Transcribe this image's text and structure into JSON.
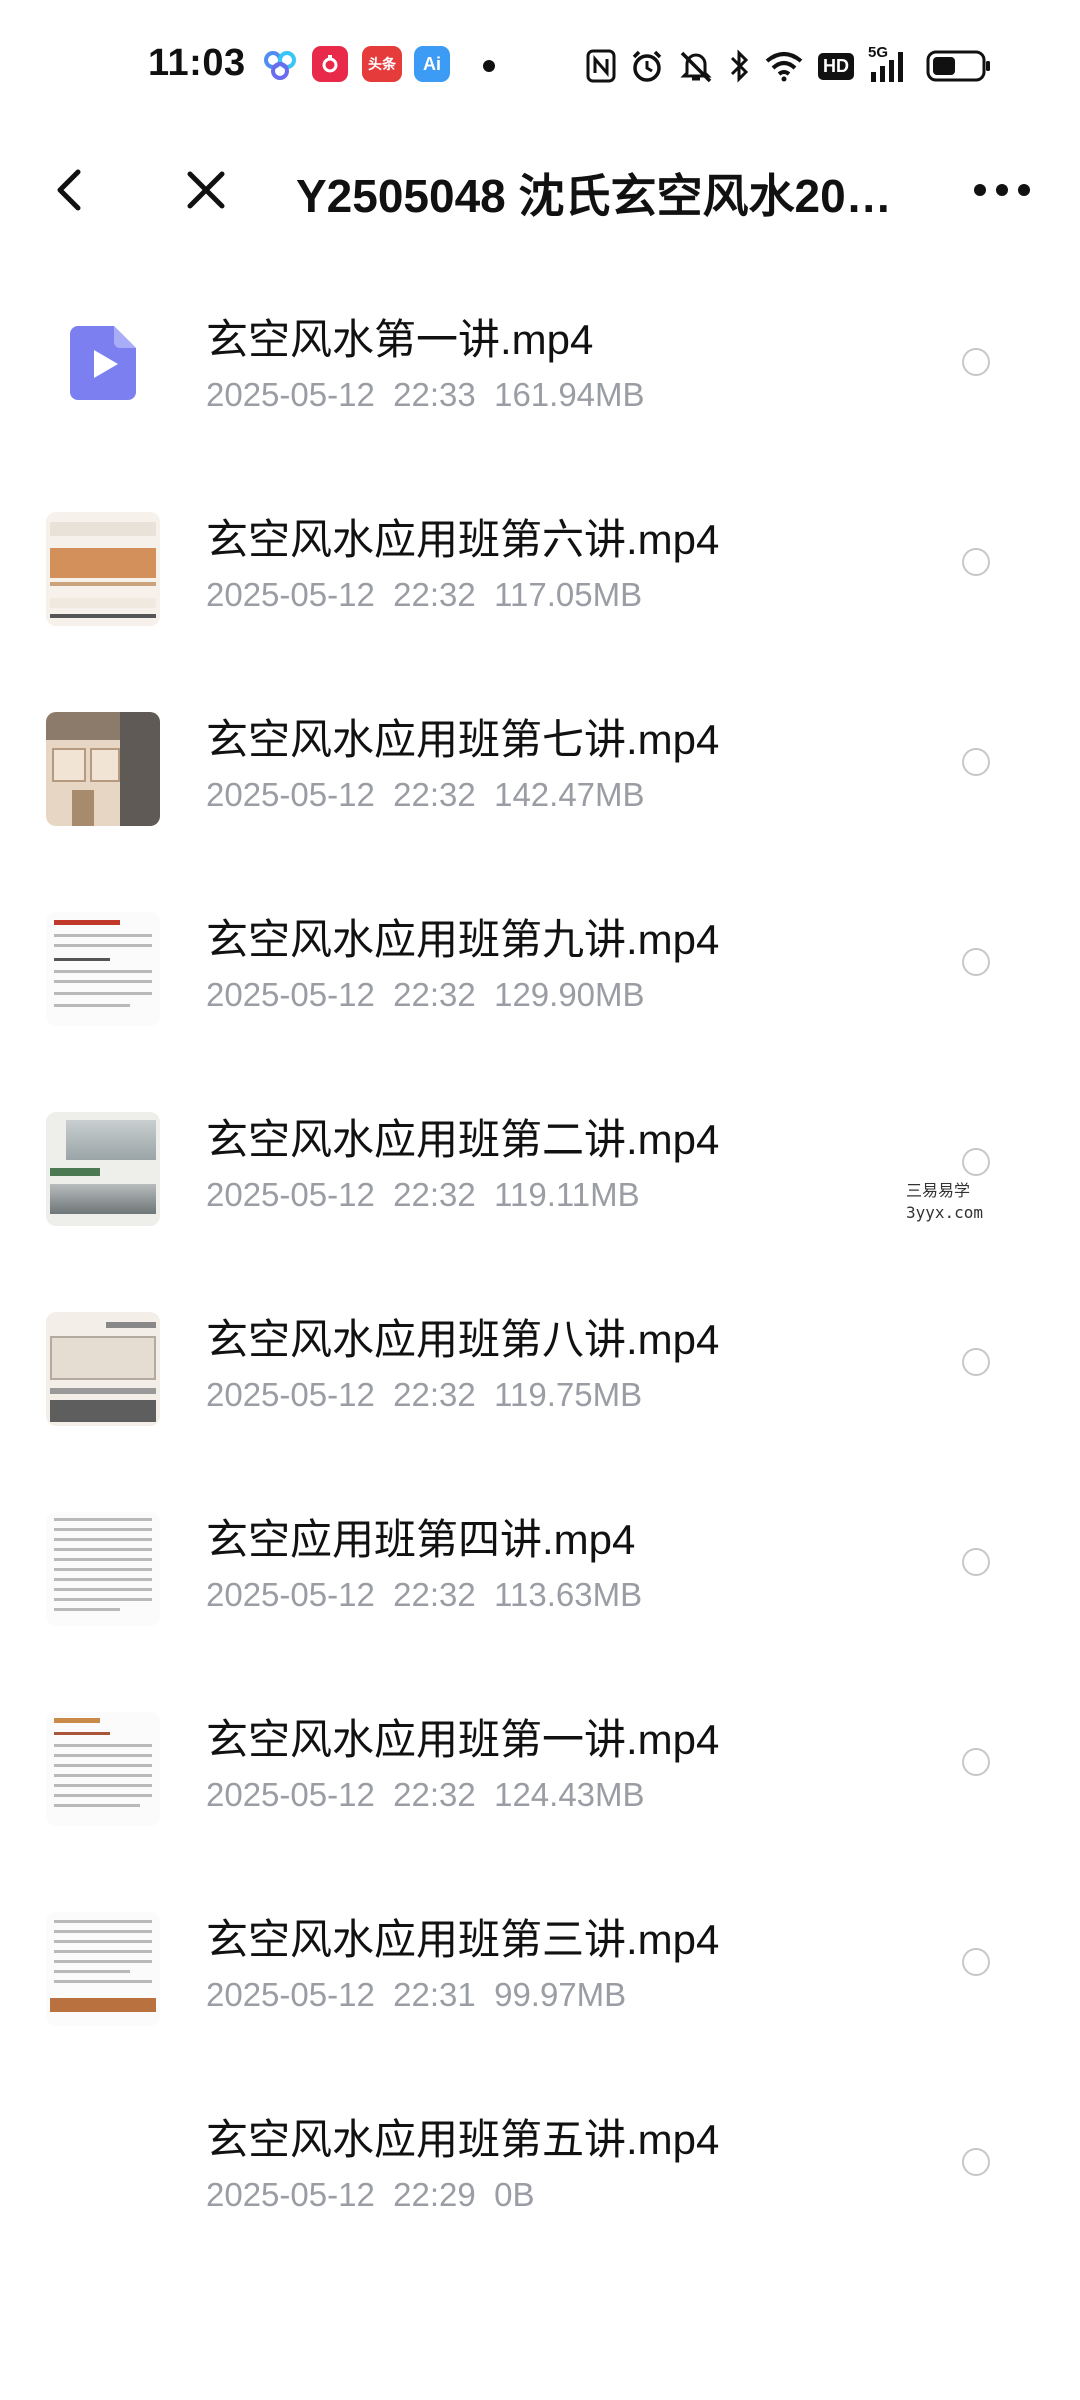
{
  "status_bar": {
    "time": "11:03",
    "apps": [
      {
        "name": "百度网盘",
        "color": "#4f8df0",
        "icon": "baidu-netdisk-icon"
      },
      {
        "name": "拼多多",
        "color": "#e8294a",
        "icon": "pinduoduo-icon"
      },
      {
        "name": "头条",
        "color": "#e63b3b",
        "icon": "toutiao-icon"
      },
      {
        "name": "Ai",
        "color": "#3c9bf5",
        "icon": "ai-app-icon"
      }
    ],
    "network_label": "HD",
    "signal_label": "5G"
  },
  "header": {
    "title": "Y2505048 沈氏玄空风水2025..."
  },
  "files": [
    {
      "name": "玄空风水第一讲.mp4",
      "date": "2025-05-12",
      "time": "22:33",
      "size": "161.94MB",
      "thumb": "video-icon"
    },
    {
      "name": "玄空风水应用班第六讲.mp4",
      "date": "2025-05-12",
      "time": "22:32",
      "size": "117.05MB",
      "thumb": "slide-orange"
    },
    {
      "name": "玄空风水应用班第七讲.mp4",
      "date": "2025-05-12",
      "time": "22:32",
      "size": "142.47MB",
      "thumb": "building"
    },
    {
      "name": "玄空风水应用班第九讲.mp4",
      "date": "2025-05-12",
      "time": "22:32",
      "size": "129.90MB",
      "thumb": "doc-red"
    },
    {
      "name": "玄空风水应用班第二讲.mp4",
      "date": "2025-05-12",
      "time": "22:32",
      "size": "119.11MB",
      "thumb": "landscape"
    },
    {
      "name": "玄空风水应用班第八讲.mp4",
      "date": "2025-05-12",
      "time": "22:32",
      "size": "119.75MB",
      "thumb": "room"
    },
    {
      "name": "玄空应用班第四讲.mp4",
      "date": "2025-05-12",
      "time": "22:32",
      "size": "113.63MB",
      "thumb": "doc-plain"
    },
    {
      "name": "玄空风水应用班第一讲.mp4",
      "date": "2025-05-12",
      "time": "22:32",
      "size": "124.43MB",
      "thumb": "doc-brown"
    },
    {
      "name": "玄空风水应用班第三讲.mp4",
      "date": "2025-05-12",
      "time": "22:31",
      "size": "99.97MB",
      "thumb": "doc-footer"
    },
    {
      "name": "玄空风水应用班第五讲.mp4",
      "date": "2025-05-12",
      "time": "22:29",
      "size": "0B",
      "thumb": "none"
    }
  ],
  "watermark": {
    "line1": "三易易学",
    "line2": "3yyx.com"
  },
  "colors": {
    "accent_video": "#7b7ff0",
    "meta_text": "#9a9da3",
    "radio_border": "#c8c8cc"
  }
}
